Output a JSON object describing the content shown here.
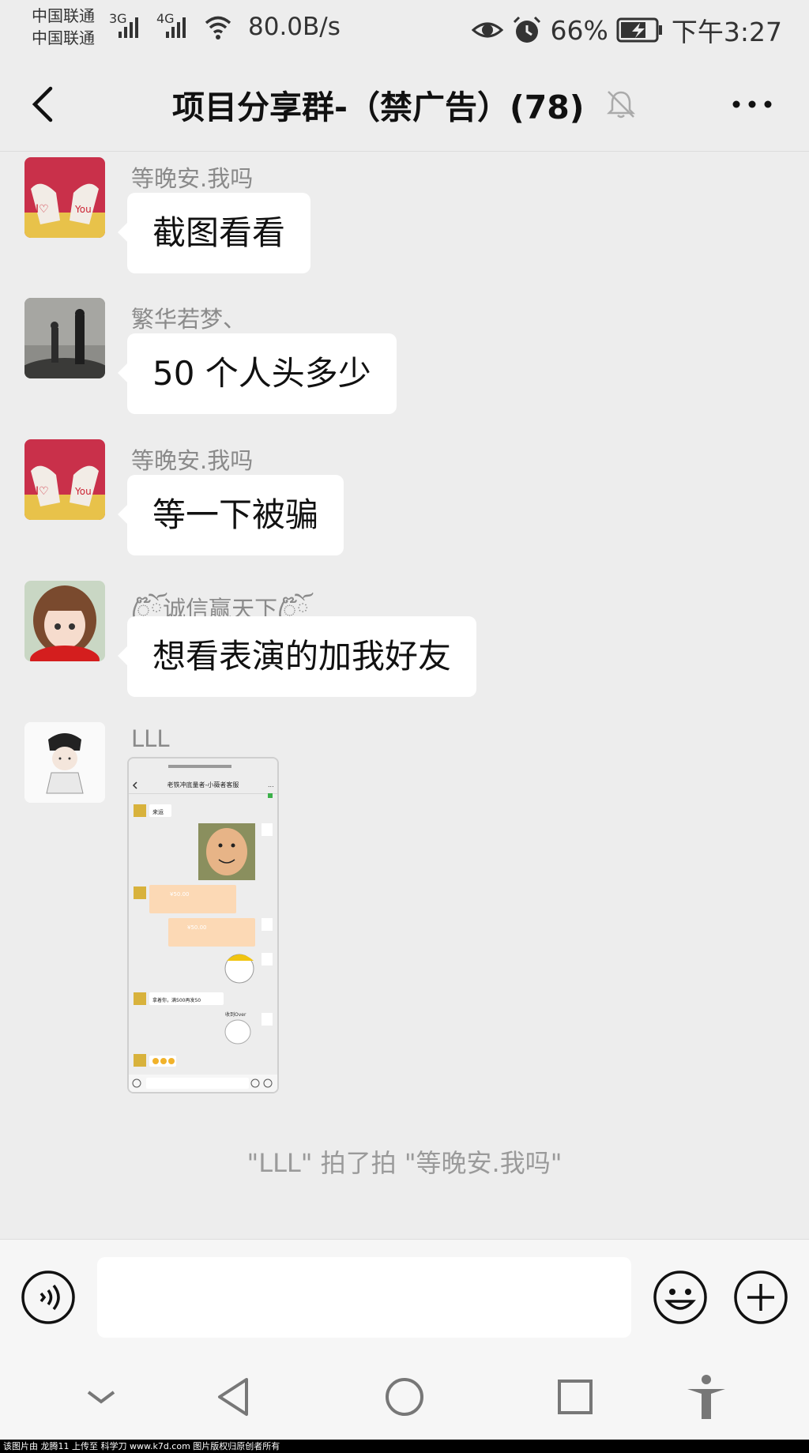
{
  "status_bar": {
    "carrier_1": "中国联通",
    "carrier_2": "中国联通",
    "network_1": "3G",
    "network_2": "4G",
    "speed": "80.0B/s",
    "battery": "66%",
    "time": "下午3:27",
    "icons": [
      "signal-icon",
      "wifi-icon",
      "eye-icon",
      "alarm-icon",
      "battery-charging-icon"
    ]
  },
  "header": {
    "title": "项目分享群-（禁广告）(78)",
    "icons": [
      "back-arrow-icon",
      "mute-bell-icon",
      "more-icon"
    ]
  },
  "messages": [
    {
      "sender": "等晚安.我吗",
      "text": "截图看看"
    },
    {
      "sender": "繁华若梦、",
      "text": "50 个人头多少"
    },
    {
      "sender": "等晚安.我吗",
      "text": "等一下被骗"
    },
    {
      "sender": "ꦿ໊ོ诚信赢天下ꦿ໊ོ",
      "text": "想看表演的加我好友"
    },
    {
      "sender": "LLL",
      "text": ""
    }
  ],
  "screenshot_thumbnail": {
    "title": "老铁冲底量者-小薇者客服",
    "lines": [
      "来运",
      "¥50.00",
      "¥50.00",
      "拿着你，满500再发50",
      "收到Over"
    ]
  },
  "system_note": "\"LLL\" 拍了拍 \"等晚安.我吗\"",
  "input_bar": {
    "placeholder": "",
    "icons": [
      "voice-icon",
      "emoji-icon",
      "plus-icon"
    ]
  },
  "nav_bar": {
    "icons": [
      "collapse-icon",
      "nav-back-icon",
      "home-icon",
      "recents-icon",
      "accessibility-icon"
    ]
  },
  "footer": "该图片由 龙腾11 上传至 科学刀 www.k7d.com 图片版权归原创者所有",
  "colors": {
    "background": "#ededed",
    "bubble": "#ffffff",
    "sender": "#8a8a8a"
  }
}
